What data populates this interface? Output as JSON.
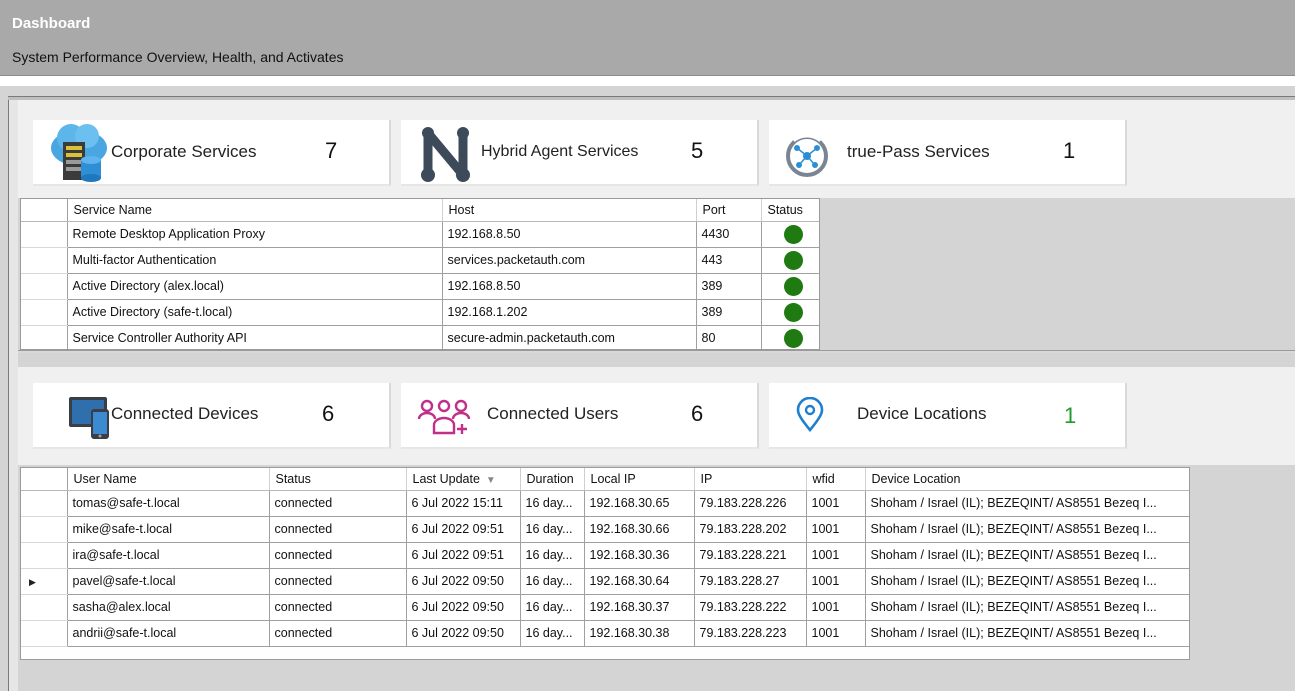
{
  "header": {
    "title": "Dashboard",
    "subtitle": "System Performance Overview, Health, and Activates"
  },
  "service_cards": [
    {
      "label": "Corporate Services",
      "count": "7",
      "icon": "cloud-server-icon"
    },
    {
      "label": "Hybrid Agent Services",
      "count": "5",
      "icon": "hybrid-n-icon"
    },
    {
      "label": "true-Pass Services",
      "count": "1",
      "icon": "network-circle-icon"
    }
  ],
  "services_table": {
    "columns": [
      "Service Name",
      "Host",
      "Port",
      "Status"
    ],
    "rows": [
      {
        "name": "Remote Desktop Application Proxy",
        "host": "192.168.8.50",
        "port": "4430",
        "status": "green"
      },
      {
        "name": "Multi-factor Authentication",
        "host": "services.packetauth.com",
        "port": "443",
        "status": "green"
      },
      {
        "name": "Active Directory (alex.local)",
        "host": "192.168.8.50",
        "port": "389",
        "status": "green"
      },
      {
        "name": "Active Directory (safe-t.local)",
        "host": "192.168.1.202",
        "port": "389",
        "status": "green"
      },
      {
        "name": "Service Controller Authority API",
        "host": "secure-admin.packetauth.com",
        "port": "80",
        "status": "green"
      }
    ]
  },
  "activity_cards": [
    {
      "label": "Connected Devices",
      "count": "6",
      "icon": "devices-icon"
    },
    {
      "label": "Connected Users",
      "count": "6",
      "icon": "users-icon"
    },
    {
      "label": "Device Locations",
      "count": "1",
      "icon": "location-pin-icon",
      "count_color": "#1e9a2e"
    }
  ],
  "users_table": {
    "columns": [
      "User Name",
      "Status",
      "Last Update",
      "Duration",
      "Local IP",
      "IP",
      "wfid",
      "Device Location"
    ],
    "rows": [
      {
        "user": "tomas@safe-t.local",
        "status": "connected",
        "last": "6 Jul 2022 15:11",
        "dur": "16 day...",
        "lip": "192.168.30.65",
        "ip": "79.183.228.226",
        "wfid": "1001",
        "loc": "Shoham / Israel (IL); BEZEQINT/ AS8551 Bezeq I..."
      },
      {
        "user": "mike@safe-t.local",
        "status": "connected",
        "last": "6 Jul 2022 09:51",
        "dur": "16 day...",
        "lip": "192.168.30.66",
        "ip": "79.183.228.202",
        "wfid": "1001",
        "loc": "Shoham / Israel (IL); BEZEQINT/ AS8551 Bezeq I..."
      },
      {
        "user": "ira@safe-t.local",
        "status": "connected",
        "last": "6 Jul 2022 09:51",
        "dur": "16 day...",
        "lip": "192.168.30.36",
        "ip": "79.183.228.221",
        "wfid": "1001",
        "loc": "Shoham / Israel (IL); BEZEQINT/ AS8551 Bezeq I..."
      },
      {
        "user": "pavel@safe-t.local",
        "status": "connected",
        "last": "6 Jul 2022 09:50",
        "dur": "16 day...",
        "lip": "192.168.30.64",
        "ip": "79.183.228.27",
        "wfid": "1001",
        "loc": "Shoham / Israel (IL); BEZEQINT/ AS8551 Bezeq I...",
        "current": true
      },
      {
        "user": "sasha@alex.local",
        "status": "connected",
        "last": "6 Jul 2022 09:50",
        "dur": "16 day...",
        "lip": "192.168.30.37",
        "ip": "79.183.228.222",
        "wfid": "1001",
        "loc": "Shoham / Israel (IL); BEZEQINT/ AS8551 Bezeq I..."
      },
      {
        "user": "andrii@safe-t.local",
        "status": "connected",
        "last": "6 Jul 2022 09:50",
        "dur": "16 day...",
        "lip": "192.168.30.38",
        "ip": "79.183.228.223",
        "wfid": "1001",
        "loc": "Shoham / Israel (IL); BEZEQINT/ AS8551 Bezeq I..."
      }
    ]
  },
  "colors": {
    "status_green": "#1f7a12",
    "header_bg": "#a9a9a9",
    "users_icon": "#c0308a",
    "devices_icon": "#2a6fb0",
    "location_icon": "#1d7fd0"
  }
}
